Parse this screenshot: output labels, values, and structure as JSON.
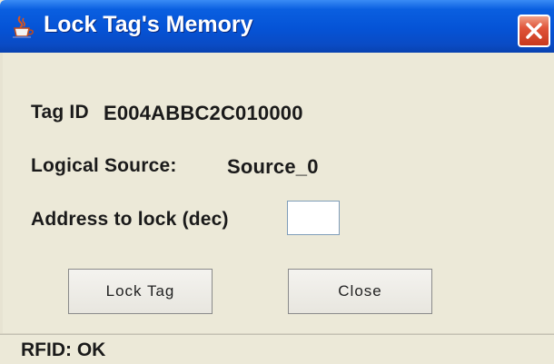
{
  "window": {
    "title": "Lock Tag's Memory",
    "icon": "java-cup-icon",
    "close_icon": "close-icon",
    "titlebar_color": "#0553d6",
    "close_color": "#e0553a"
  },
  "form": {
    "tag_id_label": "Tag ID",
    "tag_id_value": "E004ABBC2C010000",
    "logical_source_label": "Logical Source:",
    "logical_source_value": "Source_0",
    "address_label": "Address to lock (dec)",
    "address_value": ""
  },
  "buttons": {
    "lock_label": "Lock Tag",
    "close_label": "Close"
  },
  "status": {
    "text": "RFID: OK"
  }
}
